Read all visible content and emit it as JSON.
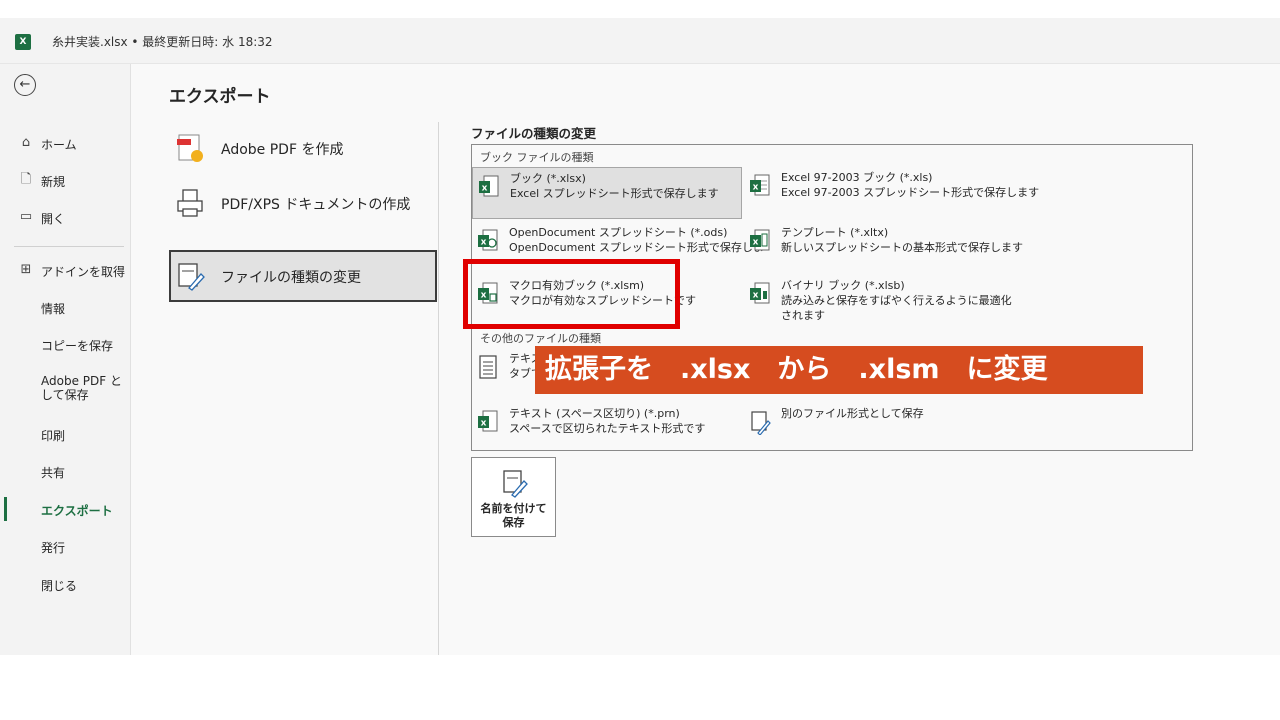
{
  "titlebar": {
    "title": "糸井実装.xlsx • 最終更新日時: 水 18:32",
    "app_badge": "X"
  },
  "sidebar": {
    "back_label": "←",
    "items": [
      {
        "label": "ホーム",
        "icon": "home-icon"
      },
      {
        "label": "新規",
        "icon": "new-file-icon"
      },
      {
        "label": "開く",
        "icon": "folder-icon"
      },
      {
        "label": "アドインを取得",
        "icon": "addin-grid-icon"
      },
      {
        "label": "情報"
      },
      {
        "label": "コピーを保存"
      },
      {
        "label": "Adobe PDF として保存"
      },
      {
        "label": "印刷"
      },
      {
        "label": "共有"
      },
      {
        "label": "エクスポート",
        "active": true
      },
      {
        "label": "発行"
      },
      {
        "label": "閉じる"
      }
    ]
  },
  "main": {
    "heading": "エクスポート",
    "export_items": [
      {
        "label": "Adobe PDF を作成",
        "icon": "adobe-pdf-icon"
      },
      {
        "label": "PDF/XPS ドキュメントの作成",
        "icon": "pdf-xps-icon"
      },
      {
        "label": "ファイルの種類の変更",
        "icon": "change-file-type-icon",
        "selected": true
      }
    ],
    "section_title": "ファイルの種類の変更",
    "workbook_group_title": "ブック ファイルの種類",
    "other_group_title": "その他のファイルの種類",
    "file_types": {
      "xlsx": {
        "t1": "ブック (*.xlsx)",
        "t2": "Excel スプレッドシート形式で保存します"
      },
      "xls": {
        "t1": "Excel 97-2003 ブック (*.xls)",
        "t2": "Excel 97-2003 スプレッドシート形式で保存します"
      },
      "ods": {
        "t1": "OpenDocument スプレッドシート (*.ods)",
        "t2": "OpenDocument スプレッドシート形式で保存しま"
      },
      "xltx": {
        "t1": "テンプレート (*.xltx)",
        "t2": "新しいスプレッドシートの基本形式で保存します"
      },
      "xlsm": {
        "t1": "マクロ有効ブック (*.xlsm)",
        "t2": "マクロが有効なスプレッドシートです"
      },
      "xlsb": {
        "t1": "バイナリ ブック (*.xlsb)",
        "t2": "読み込みと保存をすばやく行えるように最適化されます"
      },
      "txt": {
        "t1": "テキス",
        "t2": "タブで"
      },
      "prn": {
        "t1": "テキスト (スペース区切り) (*.prn)",
        "t2": "スペースで区切られたテキスト形式です"
      },
      "other": {
        "t1": "別のファイル形式として保存"
      }
    },
    "save_as_label": "名前を付けて保存",
    "annotation_banner": "拡張子を　.xlsx　から　.xlsm　に変更"
  },
  "colors": {
    "excel_green": "#1d6f42",
    "highlight_red": "#e00000",
    "banner_orange": "#d64c1f"
  }
}
